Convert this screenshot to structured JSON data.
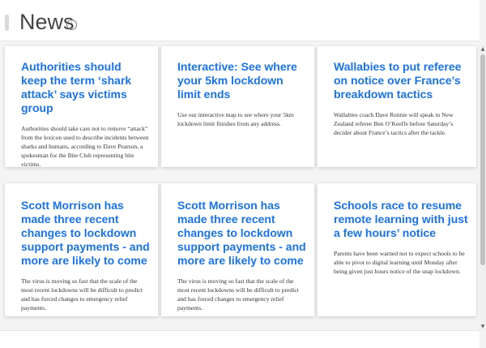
{
  "header": {
    "title": "News",
    "info_icon": "info-icon"
  },
  "cards": [
    {
      "title": "Authorities should keep the term ‘shark attack’ says victims group",
      "summary": "Authorities should take care not to remove “attack” from the lexicon used to describe incidents between sharks and humans, according to Dave Pearson, a spokesman for the Bite Club representing bite victims."
    },
    {
      "title": "Interactive: See where your 5km lockdown limit ends",
      "summary": "Use our interactive map to see where your 5km lockdown limit finishes from any address."
    },
    {
      "title": "Wallabies to put referee on notice over France’s breakdown tactics",
      "summary": "Wallabies coach Dave Rennie will speak to New Zealand referee Ben O’Keeffe before Saturday’s decider about France’s tactics after the tackle."
    },
    {
      "title": "Scott Morrison has made three recent changes to lockdown support payments - and more are likely to come",
      "summary": "The virus is moving so fast that the scale of the most recent lockdowns will be difficult to predict and has forced changes to emergency relief payments."
    },
    {
      "title": "Scott Morrison has made three recent changes to lockdown support payments - and more are likely to come",
      "summary": "The virus is moving so fast that the scale of the most recent lockdowns will be difficult to predict and has forced changes to emergency relief payments."
    },
    {
      "title": "Schools race to resume remote learning with just a few hours’ notice",
      "summary": "Parents have been warned not to expect schools to be able to pivot to digital learning until Monday after being given just hours notice of the snap lockdown."
    }
  ],
  "colors": {
    "headline": "#1a73e8",
    "background": "#f3f3f3",
    "card": "#ffffff"
  }
}
